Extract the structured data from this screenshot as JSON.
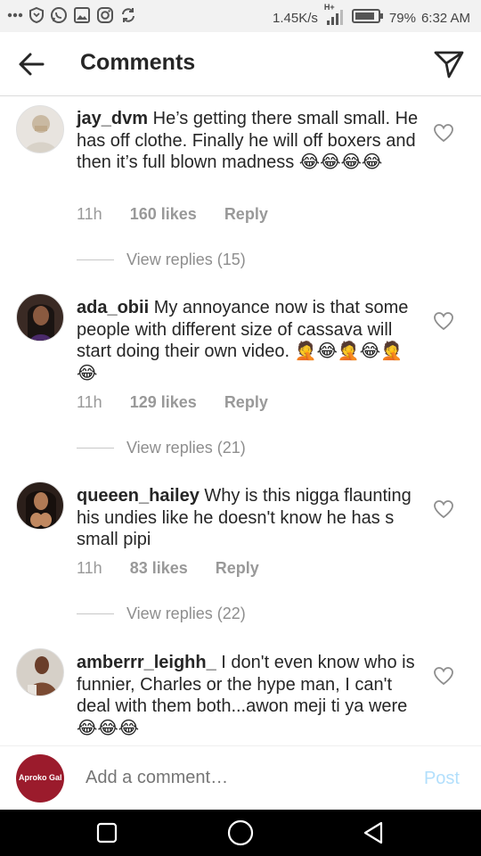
{
  "status_bar": {
    "net_speed": "1.45K/s",
    "network": "H+",
    "battery": "79%",
    "time": "6:32 AM"
  },
  "header": {
    "title": "Comments"
  },
  "comments": [
    {
      "username": "jay_dvm",
      "text": "He’s getting there small small. He has off clothe. Finally he will off boxers and then it’s full blown madness 😂😂😂😂",
      "time": "11h",
      "likes": "160 likes",
      "reply": "Reply",
      "view_replies": "View replies (15)"
    },
    {
      "username": "ada_obii",
      "text": "My annoyance now is that some people with different size of cassava will start doing their own video. 🤦😂🤦😂🤦😂",
      "time": "11h",
      "likes": "129 likes",
      "reply": "Reply",
      "view_replies": "View replies (21)"
    },
    {
      "username": "queeen_hailey",
      "text": "Why is this nigga flaunting his undies like he doesn't know he has s small pipi",
      "time": "11h",
      "likes": "83 likes",
      "reply": "Reply",
      "view_replies": "View replies (22)"
    },
    {
      "username": "amberrr_leighh_",
      "text": "I don't even know who is funnier, Charles or the hype man, I can't deal with them both...awon meji ti ya were 😂😂😂"
    }
  ],
  "add_comment": {
    "placeholder": "Add a comment…",
    "post_label": "Post",
    "avatar_text": "Aproko Gal"
  },
  "colors": {
    "post": "#b2dffc",
    "meta": "#999999",
    "nav_bg": "#000000"
  }
}
